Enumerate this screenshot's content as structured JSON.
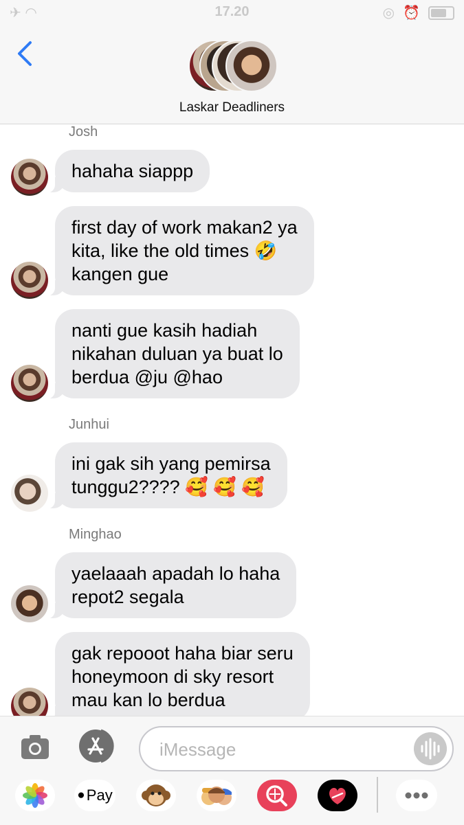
{
  "status_bar": {
    "time": "17.20"
  },
  "header": {
    "group_name": "Laskar Deadliners"
  },
  "messages": [
    {
      "sender": "Josh",
      "lines": [
        "hahaha siappp"
      ]
    },
    {
      "sender": "",
      "lines": [
        "first day of work makan2 ya",
        "kita, like the old times 🤣",
        "kangen gue"
      ]
    },
    {
      "sender": "",
      "lines": [
        "nanti gue kasih hadiah",
        "nikahan duluan ya buat lo",
        "berdua @ju @hao"
      ]
    },
    {
      "sender": "Junhui",
      "lines": [
        "ini gak sih yang pemirsa",
        "tunggu2???? 🥰 🥰 🥰"
      ]
    },
    {
      "sender": "Minghao",
      "lines": [
        "yaelaaah apadah lo haha",
        "repot2 segala"
      ]
    },
    {
      "sender": "",
      "lines": [
        "gak repooot haha biar seru",
        "honeymoon di sky resort",
        "mau kan lo berdua"
      ]
    }
  ],
  "input": {
    "placeholder": "iMessage"
  },
  "apps": {
    "applepay_label": "Pay"
  },
  "icons": {
    "back": "chevron-left-icon",
    "camera": "camera-icon",
    "appstore": "app-store-icon",
    "audio": "audio-waveform-icon",
    "photos": "photos-app-icon",
    "applepay": "apple-pay-icon",
    "animoji": "monkey-animoji-icon",
    "memoji": "memoji-stickers-icon",
    "images": "search-images-icon",
    "digitaltouch": "digital-touch-icon",
    "more": "more-icon"
  },
  "colors": {
    "accent": "#2f7bf5",
    "bubble": "#e9e9eb",
    "sender": "#7a7a7a"
  }
}
